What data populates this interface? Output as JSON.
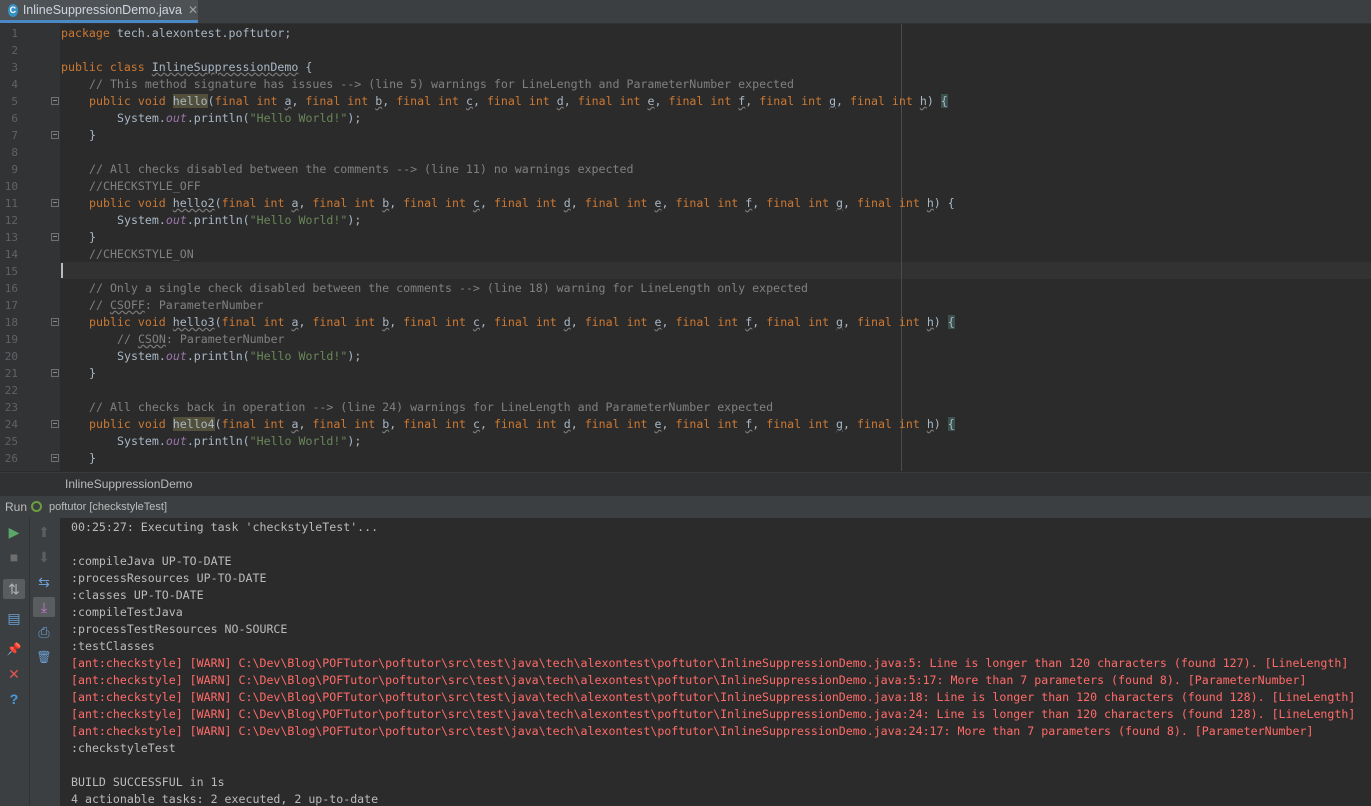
{
  "tab": {
    "icon_letter": "C",
    "label": "InlineSuppressionDemo.java",
    "close": "✕"
  },
  "editor": {
    "line_numbers": [
      "1",
      "2",
      "3",
      "4",
      "5",
      "6",
      "7",
      "8",
      "9",
      "10",
      "11",
      "12",
      "13",
      "14",
      "15",
      "16",
      "17",
      "18",
      "19",
      "20",
      "21",
      "22",
      "23",
      "24",
      "25",
      "26"
    ],
    "lines": {
      "l1_kw": "package",
      "l1_rest": " tech.alexontest.poftutor;",
      "l3_kw": "public class",
      "l3_sp": " ",
      "l3_name": "InlineSuppressionDemo",
      "l3_rest": " {",
      "l4": "// This method signature has issues --> (line 5) warnings for LineLength and ParameterNumber expected",
      "m5_name": "hello",
      "m11_name": "hello2",
      "m18_name": "hello3",
      "m24_name": "hello4",
      "sig_kw1": "public void",
      "sig_open": "(",
      "sig_final_int": "final int",
      "sig_comma": ", ",
      "params": [
        "a",
        "b",
        "c",
        "d",
        "e",
        "f",
        "g",
        "h"
      ],
      "sig_close": ") ",
      "sig_brace": "{",
      "print_system": "System.",
      "print_out": "out",
      "print_mid": ".println(",
      "print_str": "\"Hello World!\"",
      "print_end": ");",
      "close_brace": "}",
      "l9": "// All checks disabled between the comments --> (line 11) no warnings expected",
      "l10": "//CHECKSTYLE_OFF",
      "l14": "//CHECKSTYLE_ON",
      "l16": "// Only a single check disabled between the comments --> (line 18) warning for LineLength only expected",
      "l17_a": "// ",
      "l17_b": "CSOFF",
      "l17_c": ": ParameterNumber",
      "l19_a": "// ",
      "l19_b": "CSON",
      "l19_c": ": ParameterNumber",
      "l23": "// All checks back in operation --> (line 24) warnings for LineLength and ParameterNumber expected"
    }
  },
  "breadcrumb": "InlineSuppressionDemo",
  "run": {
    "label": "Run",
    "task": "poftutor [checkstyleTest]"
  },
  "console": {
    "lines": [
      {
        "text": "00:25:27: Executing task 'checkstyleTest'...",
        "warn": false
      },
      {
        "text": "",
        "warn": false
      },
      {
        "text": ":compileJava UP-TO-DATE",
        "warn": false
      },
      {
        "text": ":processResources UP-TO-DATE",
        "warn": false
      },
      {
        "text": ":classes UP-TO-DATE",
        "warn": false
      },
      {
        "text": ":compileTestJava",
        "warn": false
      },
      {
        "text": ":processTestResources NO-SOURCE",
        "warn": false
      },
      {
        "text": ":testClasses",
        "warn": false
      },
      {
        "text": "[ant:checkstyle] [WARN] C:\\Dev\\Blog\\POFTutor\\poftutor\\src\\test\\java\\tech\\alexontest\\poftutor\\InlineSuppressionDemo.java:5: Line is longer than 120 characters (found 127). [LineLength]",
        "warn": true
      },
      {
        "text": "[ant:checkstyle] [WARN] C:\\Dev\\Blog\\POFTutor\\poftutor\\src\\test\\java\\tech\\alexontest\\poftutor\\InlineSuppressionDemo.java:5:17: More than 7 parameters (found 8). [ParameterNumber]",
        "warn": true
      },
      {
        "text": "[ant:checkstyle] [WARN] C:\\Dev\\Blog\\POFTutor\\poftutor\\src\\test\\java\\tech\\alexontest\\poftutor\\InlineSuppressionDemo.java:18: Line is longer than 120 characters (found 128). [LineLength]",
        "warn": true
      },
      {
        "text": "[ant:checkstyle] [WARN] C:\\Dev\\Blog\\POFTutor\\poftutor\\src\\test\\java\\tech\\alexontest\\poftutor\\InlineSuppressionDemo.java:24: Line is longer than 120 characters (found 128). [LineLength]",
        "warn": true
      },
      {
        "text": "[ant:checkstyle] [WARN] C:\\Dev\\Blog\\POFTutor\\poftutor\\src\\test\\java\\tech\\alexontest\\poftutor\\InlineSuppressionDemo.java:24:17: More than 7 parameters (found 8). [ParameterNumber]",
        "warn": true
      },
      {
        "text": ":checkstyleTest",
        "warn": false
      },
      {
        "text": "",
        "warn": false
      },
      {
        "text": "BUILD SUCCESSFUL in 1s",
        "warn": false
      },
      {
        "text": "4 actionable tasks: 2 executed, 2 up-to-date",
        "warn": false
      }
    ]
  },
  "toolbar": {
    "run_icon": "▶",
    "stop_icon": "■",
    "sort_icon": "⇅",
    "layout_icon": "▤",
    "pin_icon": "📌",
    "close_icon": "✕",
    "help_icon": "?",
    "up_icon": "⬆",
    "down_icon": "⬇",
    "soft_wrap_icon": "⇆",
    "scroll_end_icon": "⤓",
    "print_icon": "⎙",
    "trash_icon": "🗑"
  }
}
